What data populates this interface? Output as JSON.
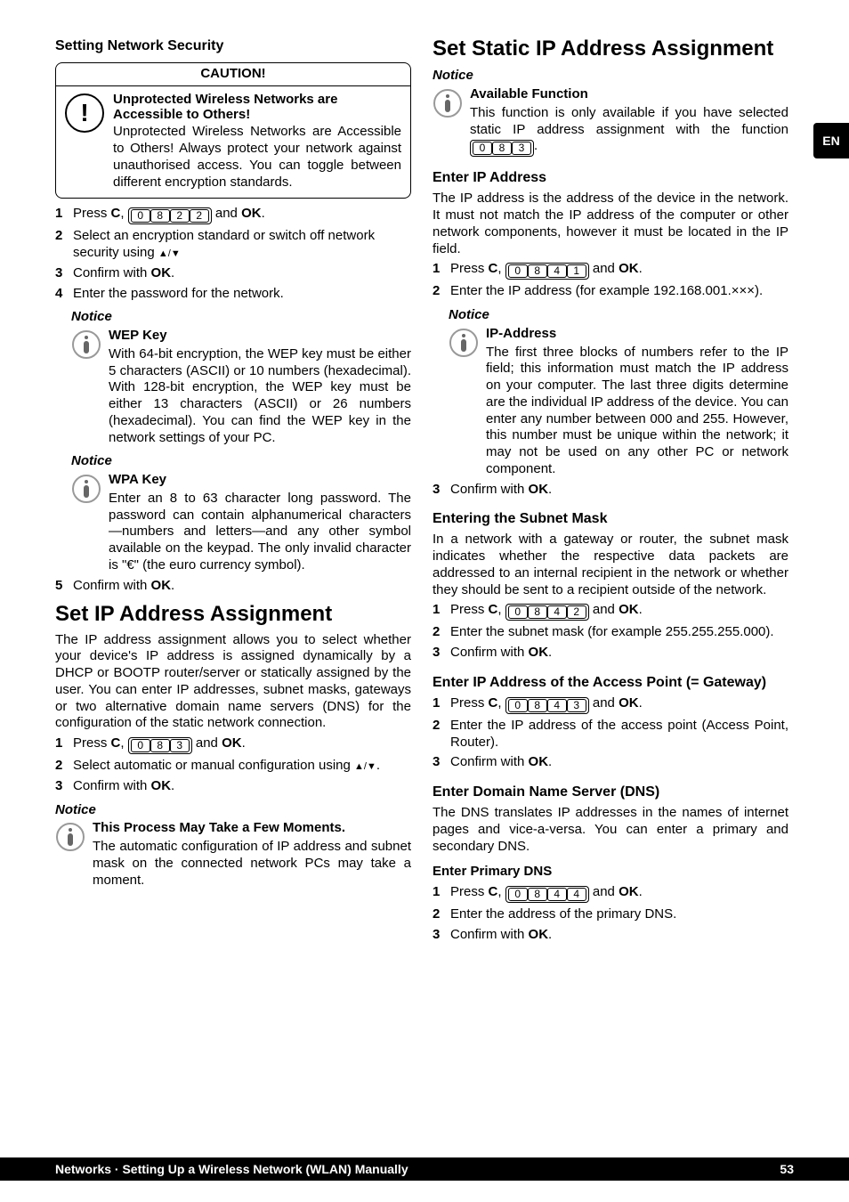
{
  "lang_tab": "EN",
  "footer": {
    "left": "Networks · Setting Up a Wireless Network (WLAN) Manually",
    "right": "53"
  },
  "left": {
    "h_setting_net_sec": "Setting Network Security",
    "caution_head": "CAUTION!",
    "caution_title": "Unprotected Wireless Networks are Accessible to Others!",
    "caution_text": "Unprotected Wireless Networks are Accessible to Others! Always protect your network against unauthorised access. You can toggle between different encryption standards.",
    "steps_a": {
      "s1_pre": "Press ",
      "s1_C": "C",
      "s1_comma": ", ",
      "s1_keys": [
        "0",
        "8",
        "2",
        "2"
      ],
      "s1_and": " and ",
      "s1_ok": "OK",
      "s1_end": ".",
      "s2": "Select an encryption standard or switch off network security using ",
      "s3_pre": "Confirm with ",
      "s3_ok": "OK",
      "s3_end": ".",
      "s4": "Enter the password for the network."
    },
    "notice_label": "Notice",
    "wep_title": "WEP Key",
    "wep_text": "With 64-bit encryption, the WEP key must be either 5 characters (ASCII) or 10 numbers (hexadecimal). With 128-bit encryption, the WEP key must be either 13 characters (ASCII) or 26 numbers (hexadecimal). You can find the WEP key in the network settings of your PC.",
    "wpa_title": "WPA Key",
    "wpa_text": "Enter an 8 to 63 character long password. The password can contain alphanumerical characters—numbers and letters—and any other symbol available on the keypad. The only invalid character is \"€\" (the euro currency symbol).",
    "step5_pre": "Confirm with ",
    "step5_ok": "OK",
    "step5_end": ".",
    "h_set_ip_assign": "Set IP Address Assignment",
    "ip_assign_para": "The IP address assignment allows you to select whether your device's IP address is assigned dynamically by a DHCP or BOOTP router/server or statically assigned by the user. You can enter IP addresses, subnet masks, gateways or two alternative domain name servers (DNS) for the configuration of the static network connection.",
    "steps_b": {
      "s1_keys": [
        "0",
        "8",
        "3"
      ],
      "s2": "Select automatic or manual configuration using ",
      "s3_pre": "Confirm with ",
      "s3_ok": "OK",
      "s3_end": "."
    },
    "proc_notice_title": "This Process May Take a Few Moments.",
    "proc_notice_text": "The automatic configuration of IP address and subnet mask on the connected network PCs may take a moment."
  },
  "right": {
    "h_static": "Set Static IP Address Assignment",
    "notice_label": "Notice",
    "avail_title": "Available Function",
    "avail_text_pre": "This function is only available if you have selected static IP address assignment with the function ",
    "avail_keys": [
      "0",
      "8",
      "3"
    ],
    "avail_text_post": ".",
    "h_enter_ip": "Enter IP Address",
    "enter_ip_para": "The IP address is the address of the device in the network. It must not match the IP address of the computer or other network components, however it must be located in the IP field.",
    "steps_ip": {
      "s1_keys": [
        "0",
        "8",
        "4",
        "1"
      ],
      "s2": "Enter the IP address (for example 192.168.001.×××)."
    },
    "ipaddr_title": "IP-Address",
    "ipaddr_text": "The first three blocks of numbers refer to the IP field; this information must match the IP address on your computer. The last three digits determine are the individual IP address of the device. You can enter any number between 000 and 255. However, this number must be unique within the network; it may not be used on any other PC or network component.",
    "step3_confirm_pre": "Confirm with ",
    "step3_confirm_ok": "OK",
    "step3_confirm_end": ".",
    "h_subnet": "Entering the Subnet Mask",
    "subnet_para": "In a network with a gateway or router, the subnet mask indicates whether the respective data packets are addressed to an internal recipient in the network or whether they should be sent to a recipient outside of the network.",
    "steps_sub": {
      "s1_keys": [
        "0",
        "8",
        "4",
        "2"
      ],
      "s2": "Enter the subnet mask (for example 255.255.255.000)."
    },
    "h_gateway": "Enter IP Address of the Access Point (= Gateway)",
    "steps_gw": {
      "s1_keys": [
        "0",
        "8",
        "4",
        "3"
      ],
      "s2": "Enter the IP address of the access point (Access Point, Router)."
    },
    "h_dns": "Enter Domain Name Server (DNS)",
    "dns_para": "The DNS translates IP addresses in the names of internet pages and vice-a-versa. You can enter a primary and secondary DNS.",
    "h_pridns": "Enter Primary DNS",
    "steps_pri": {
      "s1_keys": [
        "0",
        "8",
        "4",
        "4"
      ],
      "s2": "Enter the address of the primary DNS."
    },
    "press": "Press ",
    "C": "C",
    "comma": ", ",
    "and": " and ",
    "ok": "OK",
    "period": ".",
    "confirm_pre": "Confirm with ",
    "confirm_ok": "OK",
    "confirm_end": "."
  }
}
